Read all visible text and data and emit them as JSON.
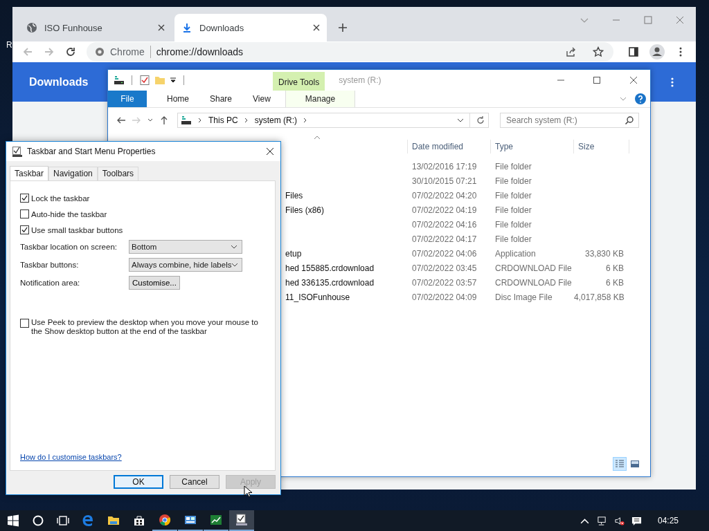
{
  "desktop": {
    "icon_label": "R"
  },
  "browser": {
    "tabs": [
      {
        "title": "ISO Funhouse",
        "selected": false,
        "kind": "globe"
      },
      {
        "title": "Downloads",
        "selected": true,
        "kind": "download"
      }
    ],
    "address": {
      "site": "Chrome",
      "url": "chrome://downloads"
    },
    "page_title": "Downloads"
  },
  "explorer": {
    "context_tab": "Drive Tools",
    "title": "system (R:)",
    "ribbon_tabs": [
      {
        "label": "File",
        "kind": "file"
      },
      {
        "label": "Home",
        "kind": "plain"
      },
      {
        "label": "Share",
        "kind": "plain"
      },
      {
        "label": "View",
        "kind": "plain"
      },
      {
        "label": "Manage",
        "kind": "context"
      }
    ],
    "breadcrumb": [
      "This PC",
      "system (R:)"
    ],
    "search": {
      "placeholder": "Search system (R:)"
    },
    "columns": [
      "Date modified",
      "Type",
      "Size"
    ],
    "rows": [
      {
        "date": "13/02/2016 17:19",
        "type": "File folder"
      },
      {
        "date": "30/10/2015 07:21",
        "type": "File folder"
      },
      {
        "name": "Files",
        "date": "07/02/2022 04:20",
        "type": "File folder"
      },
      {
        "name": "Files (x86)",
        "date": "07/02/2022 04:19",
        "type": "File folder"
      },
      {
        "date": "07/02/2022 04:16",
        "type": "File folder"
      },
      {
        "date": "07/02/2022 04:17",
        "type": "File folder"
      },
      {
        "name": "etup",
        "date": "07/02/2022 04:06",
        "type": "Application",
        "size": "33,830 KB"
      },
      {
        "name": "hed 155885.crdownload",
        "date": "07/02/2022 03:45",
        "type": "CRDOWNLOAD File",
        "size": "6 KB"
      },
      {
        "name": "hed 336135.crdownload",
        "date": "07/02/2022 03:57",
        "type": "CRDOWNLOAD File",
        "size": "6 KB"
      },
      {
        "name": "11_ISOFunhouse",
        "date": "07/02/2022 04:09",
        "type": "Disc Image File",
        "size": "4,017,858 KB"
      }
    ],
    "view_buttons": [
      {
        "kind": "details",
        "selected": true
      },
      {
        "kind": "tiles",
        "selected": false
      }
    ]
  },
  "dialog": {
    "title": "Taskbar and Start Menu Properties",
    "tabs": [
      {
        "label": "Taskbar",
        "selected": true
      },
      {
        "label": "Navigation",
        "selected": false
      },
      {
        "label": "Toolbars",
        "selected": false
      }
    ],
    "options": [
      {
        "label": "Lock the taskbar",
        "checked": true
      },
      {
        "label": "Auto-hide the taskbar",
        "checked": false
      },
      {
        "label": "Use small taskbar buttons",
        "checked": true
      }
    ],
    "fields": [
      {
        "label": "Taskbar location on screen:",
        "value": "Bottom",
        "kind": "dropdown"
      },
      {
        "label": "Taskbar buttons:",
        "value": "Always combine, hide labels",
        "kind": "dropdown"
      },
      {
        "label": "Notification area:",
        "value": "Customise...",
        "kind": "button"
      }
    ],
    "peek": {
      "label": "Use Peek to preview the desktop when you move your mouse to the Show desktop button at the end of the taskbar",
      "checked": false
    },
    "help_link": "How do I customise taskbars?",
    "buttons": [
      {
        "label": "OK",
        "default": true,
        "disabled": false
      },
      {
        "label": "Cancel",
        "default": false,
        "disabled": false
      },
      {
        "label": "Apply",
        "default": false,
        "disabled": true
      }
    ]
  },
  "taskbar": {
    "apps": [
      {
        "kind": "edge",
        "running": false,
        "active": false
      },
      {
        "kind": "folder",
        "running": false,
        "active": false
      },
      {
        "kind": "store",
        "running": false,
        "active": false
      },
      {
        "kind": "chrome",
        "running": true,
        "active": false
      },
      {
        "kind": "panel",
        "running": true,
        "active": false
      },
      {
        "kind": "chart",
        "running": true,
        "active": false
      },
      {
        "kind": "props",
        "running": true,
        "active": true
      }
    ],
    "clock": "04:25"
  }
}
